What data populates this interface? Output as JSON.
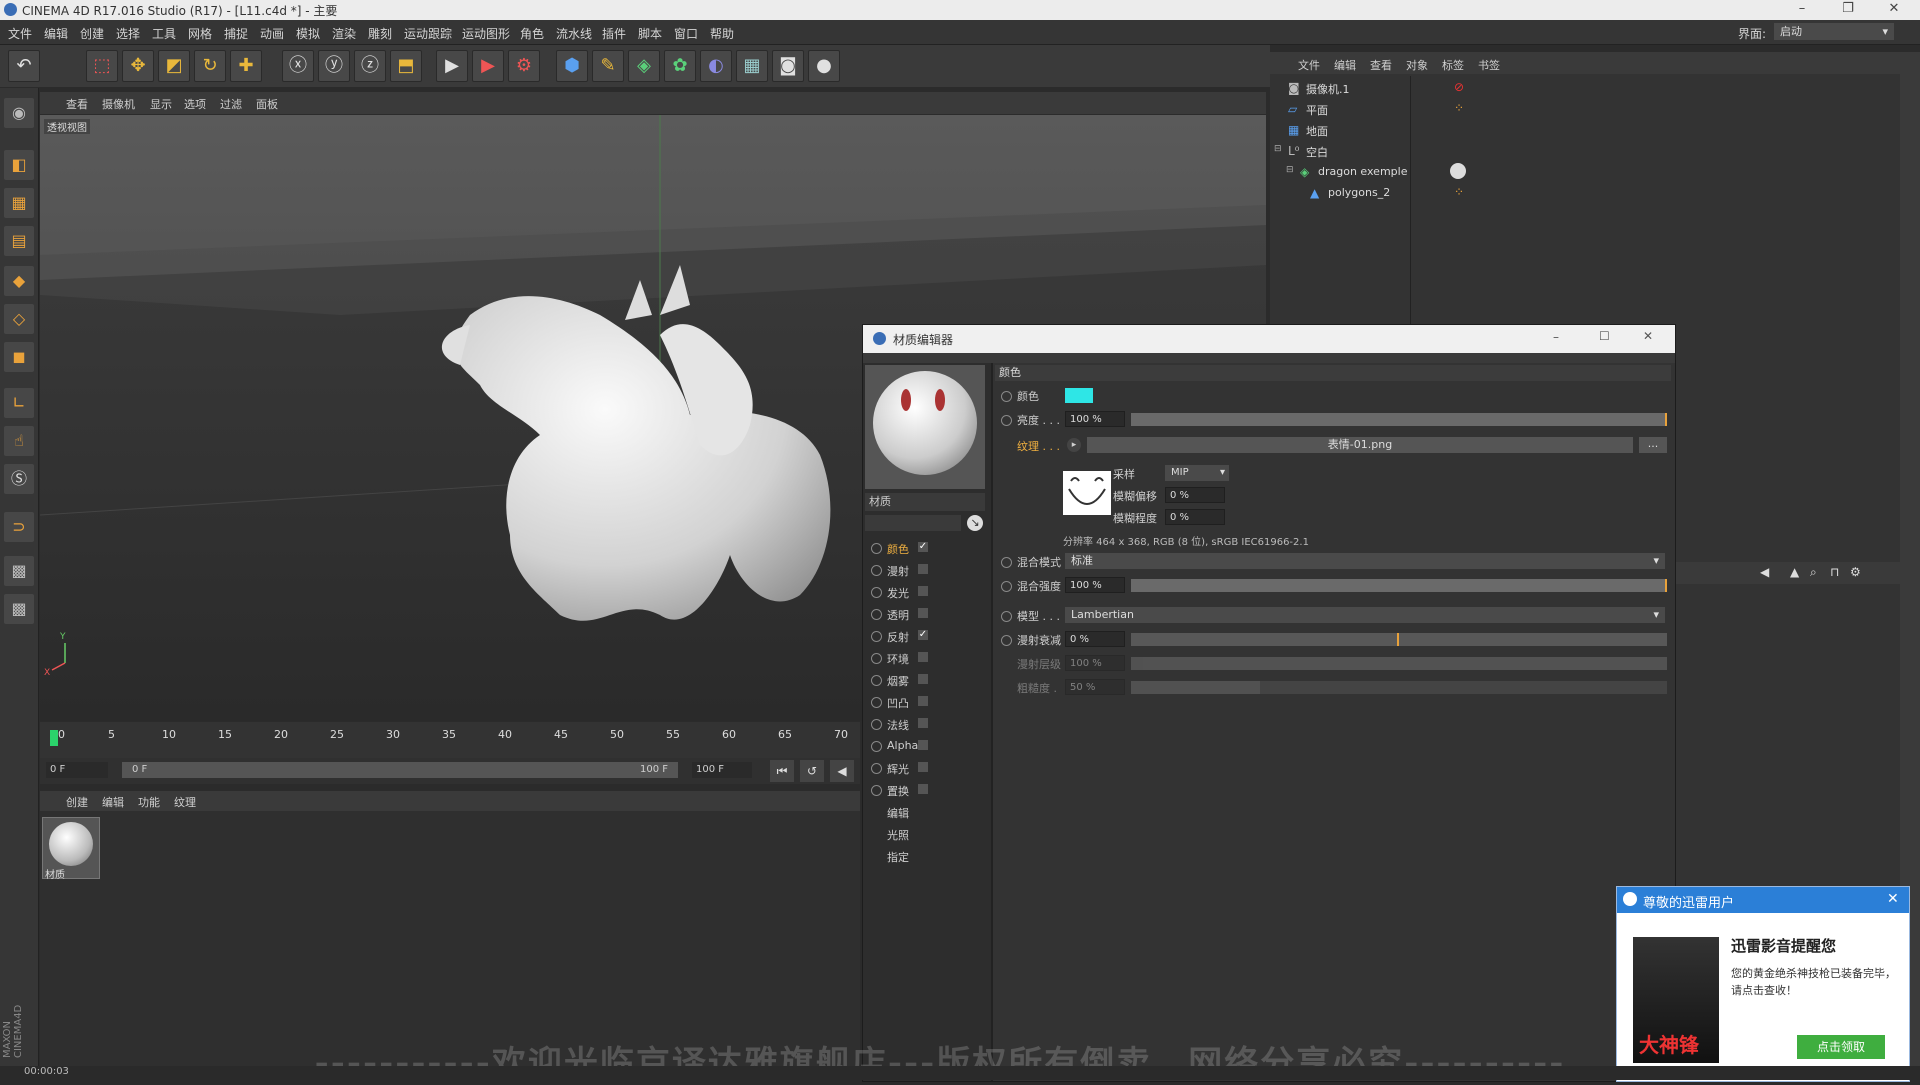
{
  "window": {
    "title": "CINEMA 4D R17.016 Studio (R17) - [L11.c4d *] - 主要",
    "interface_label": "界面:",
    "interface_value": "启动"
  },
  "menu": [
    "文件",
    "编辑",
    "创建",
    "选择",
    "工具",
    "网格",
    "捕捉",
    "动画",
    "模拟",
    "渲染",
    "雕刻",
    "运动跟踪",
    "运动图形",
    "角色",
    "流水线",
    "插件",
    "脚本",
    "窗口",
    "帮助"
  ],
  "toolbar_icons": [
    "undo-icon",
    "live-select-icon",
    "move-icon",
    "scale-icon",
    "rotate-icon",
    "axis-icon",
    "x-axis-icon",
    "y-axis-icon",
    "z-axis-icon",
    "world-coord-icon",
    "render-view-icon",
    "render-picture-icon",
    "edit-render-icon",
    "cube-icon",
    "pen-icon",
    "subdivision-icon",
    "array-icon",
    "deformer-icon",
    "floor-icon",
    "camera-icon",
    "light-icon"
  ],
  "viewport": {
    "menu": [
      "查看",
      "摄像机",
      "显示",
      "选项",
      "过滤",
      "面板"
    ],
    "label": "透视视图",
    "axis_x": "X",
    "axis_y": "Y"
  },
  "timeline": {
    "ticks": [
      "0",
      "5",
      "10",
      "15",
      "20",
      "25",
      "30",
      "35",
      "40",
      "45",
      "50",
      "55",
      "60",
      "65",
      "70"
    ],
    "current_frame": "0 F",
    "start": "0 F",
    "end": "100 F",
    "end_field": "100 F"
  },
  "material_manager": {
    "menu": [
      "创建",
      "编辑",
      "功能",
      "纹理"
    ],
    "material_name": "材质"
  },
  "object_manager": {
    "menu": [
      "文件",
      "编辑",
      "查看",
      "对象",
      "标签",
      "书签"
    ],
    "objects": [
      {
        "name": "摄像机.1"
      },
      {
        "name": "平面"
      },
      {
        "name": "地面"
      },
      {
        "name": "空白"
      },
      {
        "name": "dragon exemple"
      },
      {
        "name": "polygons_2"
      }
    ]
  },
  "material_editor": {
    "title": "材质编辑器",
    "material_name": "材质",
    "channels": [
      {
        "label": "颜色",
        "checked": true,
        "active": true
      },
      {
        "label": "漫射",
        "checked": false
      },
      {
        "label": "发光",
        "checked": false
      },
      {
        "label": "透明",
        "checked": false
      },
      {
        "label": "反射",
        "checked": true
      },
      {
        "label": "环境",
        "checked": false
      },
      {
        "label": "烟雾",
        "checked": false
      },
      {
        "label": "凹凸",
        "checked": false
      },
      {
        "label": "法线",
        "checked": false
      },
      {
        "label": "Alpha",
        "checked": false
      },
      {
        "label": "辉光",
        "checked": false
      },
      {
        "label": "置换",
        "checked": false
      },
      {
        "label": "编辑"
      },
      {
        "label": "光照"
      },
      {
        "label": "指定"
      }
    ],
    "section_title": "颜色",
    "color_label": "颜色",
    "color_value": "#2ee6e6",
    "brightness_label": "亮度 . . .",
    "brightness_value": "100 %",
    "texture_label": "纹理 . . .",
    "texture_file": "表情-01.png",
    "texture_more": "...",
    "sampling_label": "采样",
    "sampling_value": "MIP",
    "blur_offset_label": "模糊偏移",
    "blur_offset_value": "0 %",
    "blur_scale_label": "模糊程度",
    "blur_scale_value": "0 %",
    "resolution": "分辨率 464 x 368, RGB (8 位), sRGB IEC61966-2.1",
    "mix_mode_label": "混合模式",
    "mix_mode_value": "标准",
    "mix_strength_label": "混合强度",
    "mix_strength_value": "100 %",
    "model_label": "模型 . . .",
    "model_value": "Lambertian",
    "diffuse_falloff_label": "漫射衰减",
    "diffuse_falloff_value": "0 %",
    "diffuse_level_label": "漫射层级",
    "diffuse_level_value": "100 %",
    "roughness_label": "粗糙度 .",
    "roughness_value": "50 %"
  },
  "toast": {
    "header": "尊敬的迅雷用户",
    "title": "迅雷影音提醒您",
    "body": "您的黄金绝杀神技枪已装备完毕，请点击查收！",
    "button": "点击领取",
    "game_text": "大神锋"
  },
  "watermark": "-----------欢迎光临京译达雅旗舰店---版权所有倒卖、网络分享必究----------",
  "status": {
    "time": "00:00:03"
  },
  "brand": "MAXON CINEMA4D"
}
